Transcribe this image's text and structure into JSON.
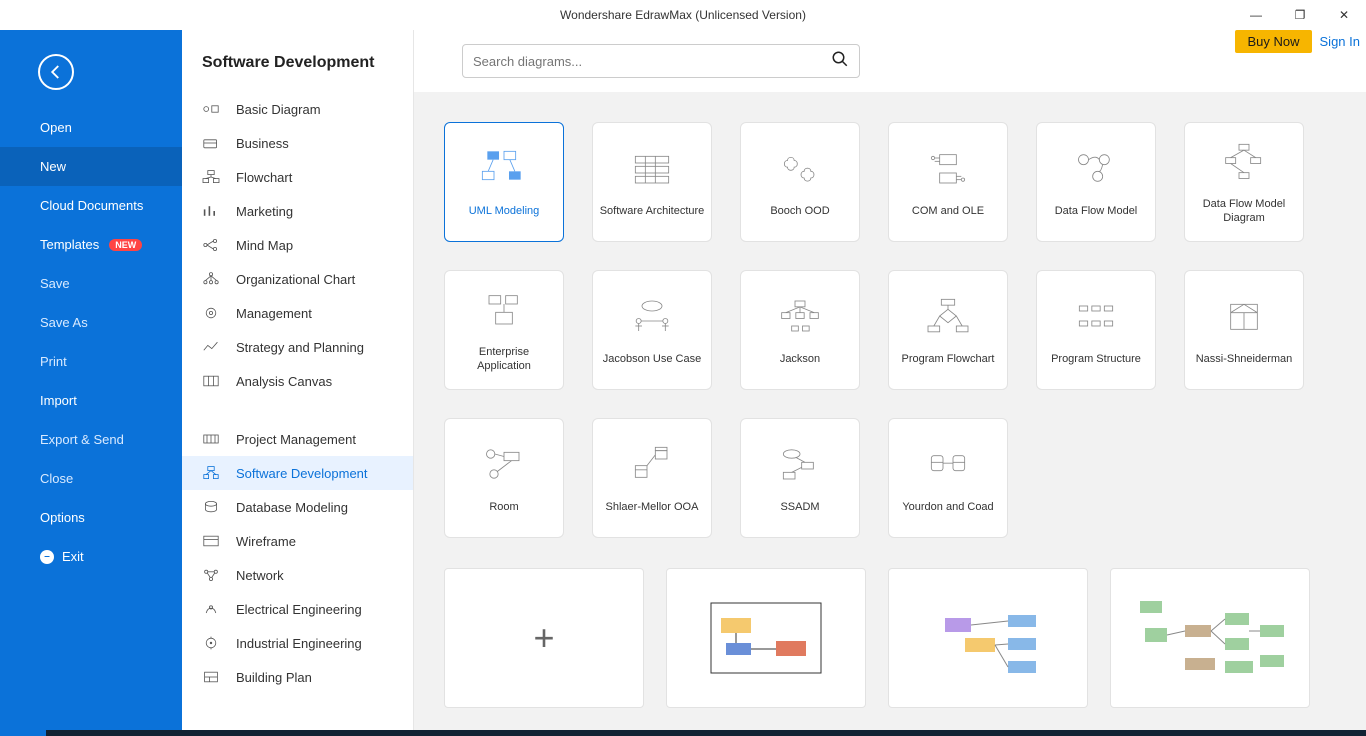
{
  "title": "Wondershare EdrawMax (Unlicensed Version)",
  "buy": "Buy Now",
  "signin": "Sign In",
  "bluenav": {
    "open": "Open",
    "new": "New",
    "cloud": "Cloud Documents",
    "templates": "Templates",
    "new_badge": "NEW",
    "save": "Save",
    "saveas": "Save As",
    "print": "Print",
    "import": "Import",
    "export": "Export & Send",
    "close": "Close",
    "options": "Options",
    "exit": "Exit"
  },
  "cat_header": "Software Development",
  "cats1": [
    "Basic Diagram",
    "Business",
    "Flowchart",
    "Marketing",
    "Mind Map",
    "Organizational Chart",
    "Management",
    "Strategy and Planning",
    "Analysis Canvas"
  ],
  "cats2": [
    "Project Management",
    "Software Development",
    "Database Modeling",
    "Wireframe",
    "Network",
    "Electrical Engineering",
    "Industrial Engineering",
    "Building Plan"
  ],
  "cat_selected": "Software Development",
  "search_placeholder": "Search diagrams...",
  "cards": [
    "UML Modeling",
    "Software Architecture",
    "Booch OOD",
    "COM and OLE",
    "Data Flow Model",
    "Data Flow Model Diagram",
    "Enterprise Application",
    "Jacobson Use Case",
    "Jackson",
    "Program Flowchart",
    "Program Structure",
    "Nassi-Shneiderman",
    "Room",
    "Shlaer-Mellor OOA",
    "SSADM",
    "Yourdon and Coad"
  ],
  "card_selected": "UML Modeling"
}
